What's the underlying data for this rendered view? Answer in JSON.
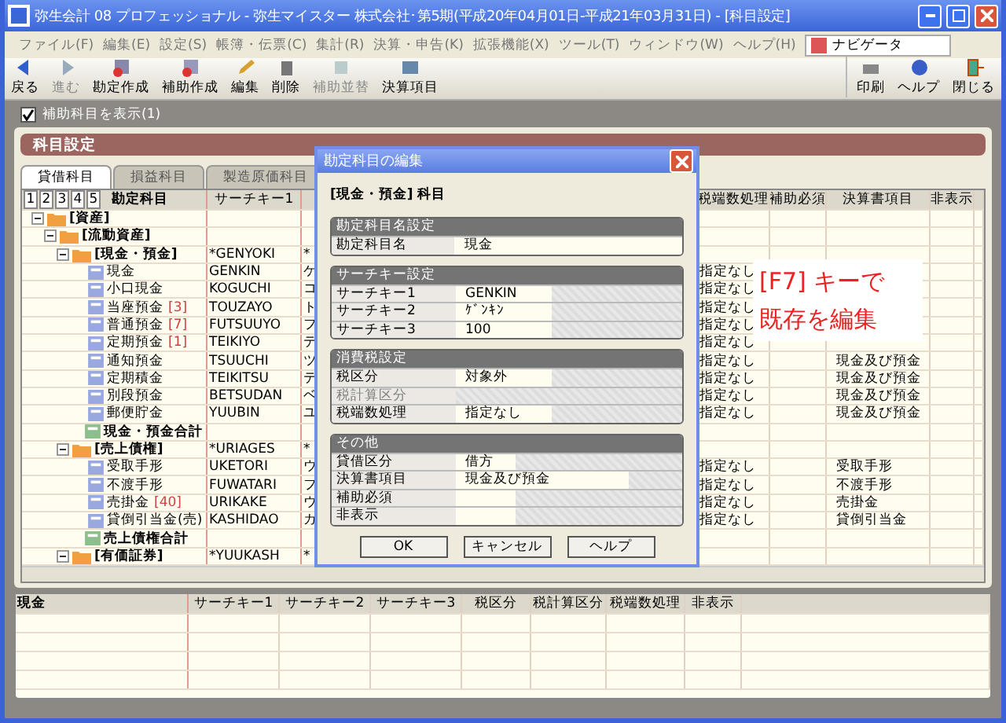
{
  "window": {
    "title": "弥生会計 08 プロフェッショナル - 弥生マイスター 株式会社･第5期(平成20年04月01日-平成21年03月31日) - [科目設定]"
  },
  "menu": [
    "ファイル(F)",
    "編集(E)",
    "設定(S)",
    "帳簿・伝票(C)",
    "集計(R)",
    "決算・申告(K)",
    "拡張機能(X)",
    "ツール(T)",
    "ウィンドウ(W)",
    "ヘルプ(H)"
  ],
  "navigator": "ナビゲータ",
  "toolbar": [
    {
      "label": "戻る",
      "kind": "back",
      "disabled": false
    },
    {
      "label": "進む",
      "kind": "forward",
      "disabled": true
    },
    {
      "label": "勘定作成",
      "kind": "create",
      "disabled": false
    },
    {
      "label": "補助作成",
      "kind": "create-sub",
      "disabled": false
    },
    {
      "label": "編集",
      "kind": "edit",
      "disabled": false
    },
    {
      "label": "削除",
      "kind": "delete",
      "disabled": false
    },
    {
      "label": "補助並替",
      "kind": "sort",
      "disabled": true
    },
    {
      "label": "決算項目",
      "kind": "report",
      "disabled": false
    }
  ],
  "toolbar_right": [
    {
      "label": "印刷",
      "kind": "print"
    },
    {
      "label": "ヘルプ",
      "kind": "help"
    },
    {
      "label": "閉じる",
      "kind": "close"
    }
  ],
  "show_sub": {
    "label": "補助科目を表示(1)",
    "checked": true
  },
  "panel_title": "科目設定",
  "tabs": [
    {
      "label": "貸借科目",
      "selected": true
    },
    {
      "label": "損益科目",
      "selected": false
    },
    {
      "label": "製造原価科目",
      "selected": false
    }
  ],
  "levels": [
    "1",
    "2",
    "3",
    "4",
    "5"
  ],
  "table": {
    "columns": [
      "勘定科目",
      "サーチキー1",
      "税端数処理",
      "補助必須",
      "決算書項目",
      "非表示"
    ],
    "tree": [
      {
        "label": "[資産]",
        "kind": "group",
        "expanded": true,
        "children": [
          {
            "label": "[流動資産]",
            "kind": "group",
            "expanded": true,
            "children": [
              {
                "label": "[現金・預金]",
                "kind": "group",
                "expanded": true,
                "key1": "*GENYOKI",
                "column_3": "*",
                "children": [
                  {
                    "label": "現金",
                    "kind": "account",
                    "key1": "GENKIN",
                    "column_3": "ケ",
                    "rounding": "指定なし"
                  },
                  {
                    "label": "小口現金",
                    "kind": "account",
                    "key1": "KOGUCHI",
                    "column_3": "コ",
                    "rounding": "指定なし"
                  },
                  {
                    "label": "当座預金",
                    "count": "[3]",
                    "kind": "account",
                    "key1": "TOUZAYO",
                    "column_3": "ト",
                    "rounding": "指定なし"
                  },
                  {
                    "label": "普通預金",
                    "count": "[7]",
                    "kind": "account",
                    "key1": "FUTSUUYO",
                    "column_3": "フ",
                    "rounding": "指定なし"
                  },
                  {
                    "label": "定期預金",
                    "count": "[1]",
                    "kind": "account",
                    "key1": "TEIKIYO",
                    "column_3": "テ",
                    "rounding": "指定なし"
                  },
                  {
                    "label": "通知預金",
                    "kind": "account",
                    "key1": "TSUUCHI",
                    "column_3": "ツ",
                    "rounding": "指定なし",
                    "item": "現金及び預金"
                  },
                  {
                    "label": "定期積金",
                    "kind": "account",
                    "key1": "TEIKITSU",
                    "column_3": "テ",
                    "rounding": "指定なし",
                    "item": "現金及び預金"
                  },
                  {
                    "label": "別段預金",
                    "kind": "account",
                    "key1": "BETSUDAN",
                    "column_3": "ベ",
                    "rounding": "指定なし",
                    "item": "現金及び預金"
                  },
                  {
                    "label": "郵便貯金",
                    "kind": "account",
                    "key1": "YUUBIN",
                    "column_3": "ユ",
                    "rounding": "指定なし",
                    "item": "現金及び預金"
                  },
                  {
                    "label": "現金・預金合計",
                    "kind": "total"
                  }
                ]
              },
              {
                "label": "[売上債権]",
                "kind": "group",
                "expanded": true,
                "key1": "*URIAGES",
                "column_3": "*",
                "children": [
                  {
                    "label": "受取手形",
                    "kind": "account",
                    "key1": "UKETORI",
                    "column_3": "ウ",
                    "rounding": "指定なし",
                    "item": "受取手形"
                  },
                  {
                    "label": "不渡手形",
                    "kind": "account",
                    "key1": "FUWATARI",
                    "column_3": "フ",
                    "rounding": "指定なし",
                    "item": "不渡手形"
                  },
                  {
                    "label": "売掛金",
                    "count": "[40]",
                    "kind": "account",
                    "key1": "URIKAKE",
                    "column_3": "ウ",
                    "rounding": "指定なし",
                    "item": "売掛金"
                  },
                  {
                    "label": "貸倒引当金(売)",
                    "kind": "account",
                    "key1": "KASHIDAO",
                    "column_3": "カ",
                    "rounding": "指定なし",
                    "item": "貸倒引当金"
                  },
                  {
                    "label": "売上債権合計",
                    "kind": "total"
                  }
                ]
              },
              {
                "label": "[有価証券]",
                "kind": "group",
                "expanded": true,
                "key1": "*YUUKASH",
                "column_3": "*"
              }
            ]
          }
        ]
      }
    ]
  },
  "callout": [
    "[F7] キーで",
    "既存を編集"
  ],
  "detail": {
    "columns": [
      "現金",
      "サーチキー1",
      "サーチキー2",
      "サーチキー3",
      "税区分",
      "税計算区分",
      "税端数処理",
      "非表示"
    ]
  },
  "dialog": {
    "title": "勘定科目の編集",
    "subtitle": "[現金・預金] 科目",
    "sections": [
      {
        "title": "勘定科目名設定",
        "rows": [
          {
            "label": "勘定科目名",
            "value": "現金",
            "kind": "text-full",
            "disabled": false
          }
        ]
      },
      {
        "title": "サーチキー設定",
        "rows": [
          {
            "label": "サーチキー1",
            "value": "GENKIN",
            "kind": "text",
            "disabled": false
          },
          {
            "label": "サーチキー2",
            "value": "ｹﾞﾝｷﾝ",
            "kind": "text",
            "disabled": false
          },
          {
            "label": "サーチキー3",
            "value": "100",
            "kind": "text",
            "disabled": false
          }
        ]
      },
      {
        "title": "消費税設定",
        "rows": [
          {
            "label": "税区分",
            "value": "対象外",
            "kind": "text",
            "disabled": false
          },
          {
            "label": "税計算区分",
            "kind": "text",
            "disabled": true
          },
          {
            "label": "税端数処理",
            "value": "指定なし",
            "kind": "text",
            "disabled": false
          }
        ]
      },
      {
        "title": "その他",
        "rows": [
          {
            "label": "貸借区分",
            "value": "借方",
            "kind": "short",
            "disabled": false
          },
          {
            "label": "決算書項目",
            "value": "現金及び預金",
            "kind": "wide",
            "disabled": false
          },
          {
            "label": "補助必須",
            "kind": "short",
            "disabled": false
          },
          {
            "label": "非表示",
            "kind": "short",
            "disabled": false
          }
        ]
      }
    ],
    "buttons": [
      "OK",
      "キャンセル",
      "ヘルプ"
    ]
  }
}
